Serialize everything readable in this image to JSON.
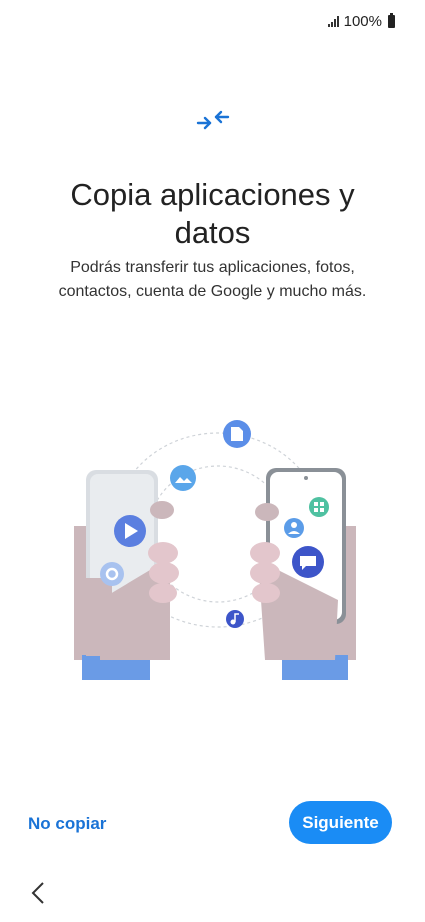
{
  "status_bar": {
    "battery_text": "100%",
    "icons": [
      "signal-icon",
      "battery-icon"
    ]
  },
  "header": {
    "icon": "transfer-arrows-icon",
    "title": "Copia aplicaciones y datos",
    "subtitle": "Podrás transferir tus aplicaciones, fotos, contactos, cuenta de Google y mucho más."
  },
  "illustration": {
    "icons": [
      "play-icon",
      "settings-icon",
      "image-icon",
      "document-icon",
      "apps-icon",
      "contact-icon",
      "message-icon",
      "music-icon"
    ]
  },
  "footer": {
    "secondary_label": "No copiar",
    "primary_label": "Siguiente"
  },
  "navigation": {
    "back_icon": "chevron-left-icon"
  },
  "colors": {
    "accent": "#1a8cf5",
    "link": "#1a73d6"
  }
}
